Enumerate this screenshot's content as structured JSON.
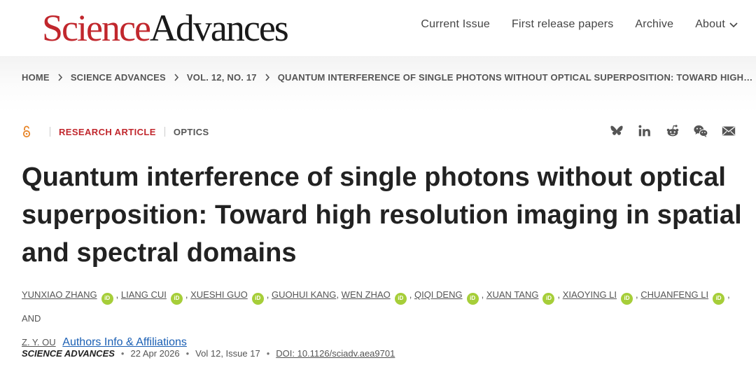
{
  "logo": {
    "part1": "Science",
    "part2": "Advances"
  },
  "nav": [
    {
      "label": "Current Issue"
    },
    {
      "label": "First release papers"
    },
    {
      "label": "Archive"
    },
    {
      "label": "About"
    }
  ],
  "breadcrumb": [
    "HOME",
    "SCIENCE ADVANCES",
    "VOL. 12, NO. 17",
    "QUANTUM INTERFERENCE OF SINGLE PHOTONS WITHOUT OPTICAL SUPERPOSITION: TOWARD HIGH…"
  ],
  "article": {
    "type": "RESEARCH ARTICLE",
    "subject": "OPTICS",
    "title": "Quantum interference of single photons without optical superposition: Toward high resolution imaging in spa­tial and spectral domains",
    "authors_and": ", AND",
    "last_author": "Z. Y. OU",
    "affiliations_link": "Authors Info & Affiliations",
    "orcid_label": "iD"
  },
  "authors": [
    "YUNXIAO ZHANG",
    "LIANG CUI",
    "XUESHI GUO",
    "GUOHUI KANG",
    "WEN ZHAO",
    "QIQI DENG",
    "XUAN TANG",
    "XIAOYING LI",
    "CHUANFENG LI"
  ],
  "citation": {
    "journal": "SCIENCE ADVANCES",
    "date": "22 Apr 2026",
    "volume": "Vol 12, Issue 17",
    "doi": "DOI: 10.1126/sciadv.aea9701"
  },
  "share_icons": [
    "bluesky-icon",
    "linkedin-icon",
    "reddit-icon",
    "wechat-icon",
    "email-icon"
  ],
  "colors": {
    "brand_red": "#c1272d",
    "orcid_green": "#a6ce39",
    "link_blue": "#1a5fb4"
  }
}
